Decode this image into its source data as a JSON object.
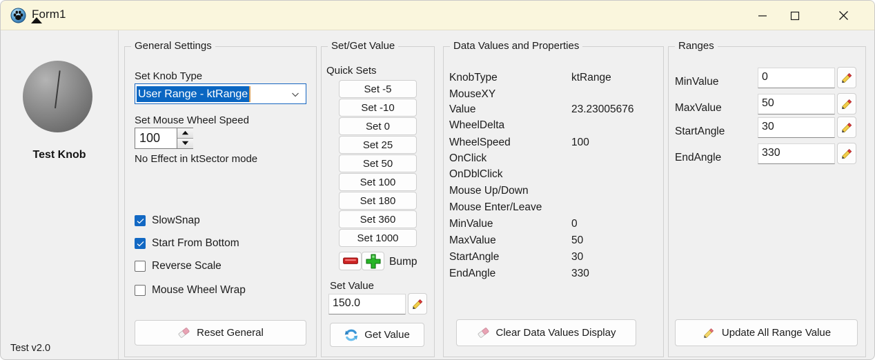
{
  "window": {
    "title": "Form1",
    "icon": "paw-app-icon",
    "controls": {
      "minimize": "minimize-icon",
      "maximize": "maximize-icon",
      "close": "close-icon"
    }
  },
  "left_panel": {
    "knob_label": "Test Knob",
    "version": "Test v2.0",
    "knob_icon": "rotary-knob"
  },
  "general_settings": {
    "title": "General Settings",
    "knob_type_label": "Set Knob Type",
    "knob_type_value": "User Range - ktRange",
    "wheel_speed_label": "Set Mouse Wheel Speed",
    "wheel_speed_value": "100",
    "no_effect_note": "No Effect in ktSector mode",
    "checkboxes": [
      {
        "label": "SlowSnap",
        "checked": true
      },
      {
        "label": "Start From Bottom",
        "checked": true
      },
      {
        "label": "Reverse Scale",
        "checked": false
      },
      {
        "label": "Mouse Wheel Wrap",
        "checked": false
      }
    ],
    "reset_button": "Reset General",
    "reset_button_icon": "eraser-icon"
  },
  "set_get_value": {
    "title": "Set/Get Value",
    "quick_sets_label": "Quick Sets",
    "quick_sets": [
      "Set -5",
      "Set -10",
      "Set 0",
      "Set 25",
      "Set 50",
      "Set 100",
      "Set 180",
      "Set 360",
      "Set 1000"
    ],
    "bump_minus_icon": "minus-red-icon",
    "bump_plus_icon": "plus-green-icon",
    "bump_label": "Bump",
    "set_value_label": "Set Value",
    "set_value_value": "150.0",
    "set_value_pencil_icon": "pencil-icon",
    "get_value_button": "Get Value",
    "get_value_icon": "refresh-icon"
  },
  "data_values": {
    "title": "Data Values and Properties",
    "rows": [
      {
        "key": "KnobType",
        "value": "ktRange"
      },
      {
        "key": "MouseXY",
        "value": ""
      },
      {
        "key": "Value",
        "value": "23.23005676"
      },
      {
        "key": "WheelDelta",
        "value": ""
      },
      {
        "key": "WheelSpeed",
        "value": "100"
      },
      {
        "key": "OnClick",
        "value": ""
      },
      {
        "key": "OnDblClick",
        "value": ""
      },
      {
        "key": "Mouse Up/Down",
        "value": ""
      },
      {
        "key": "Mouse Enter/Leave",
        "value": ""
      },
      {
        "key": "MinValue",
        "value": "0"
      },
      {
        "key": "MaxValue",
        "value": "50"
      },
      {
        "key": "StartAngle",
        "value": "30"
      },
      {
        "key": "EndAngle",
        "value": "330"
      }
    ],
    "clear_button": "Clear Data Values Display",
    "clear_button_icon": "eraser-icon"
  },
  "ranges": {
    "title": "Ranges",
    "fields": [
      {
        "label": "MinValue",
        "value": "0",
        "icon": "pencil-icon"
      },
      {
        "label": "MaxValue",
        "value": "50",
        "icon": "pencil-icon"
      },
      {
        "label": "StartAngle",
        "value": "30",
        "icon": "pencil-icon"
      },
      {
        "label": "EndAngle",
        "value": "330",
        "icon": "pencil-icon"
      }
    ],
    "update_button": "Update All Range Value",
    "update_button_icon": "pencil-icon"
  },
  "colors": {
    "titlebar": "#faf6dd",
    "window_bg": "#f0f0f0",
    "accent_selection": "#0a66c2",
    "checkbox_checked": "#1268c3",
    "group_border": "#d0d0d0"
  }
}
